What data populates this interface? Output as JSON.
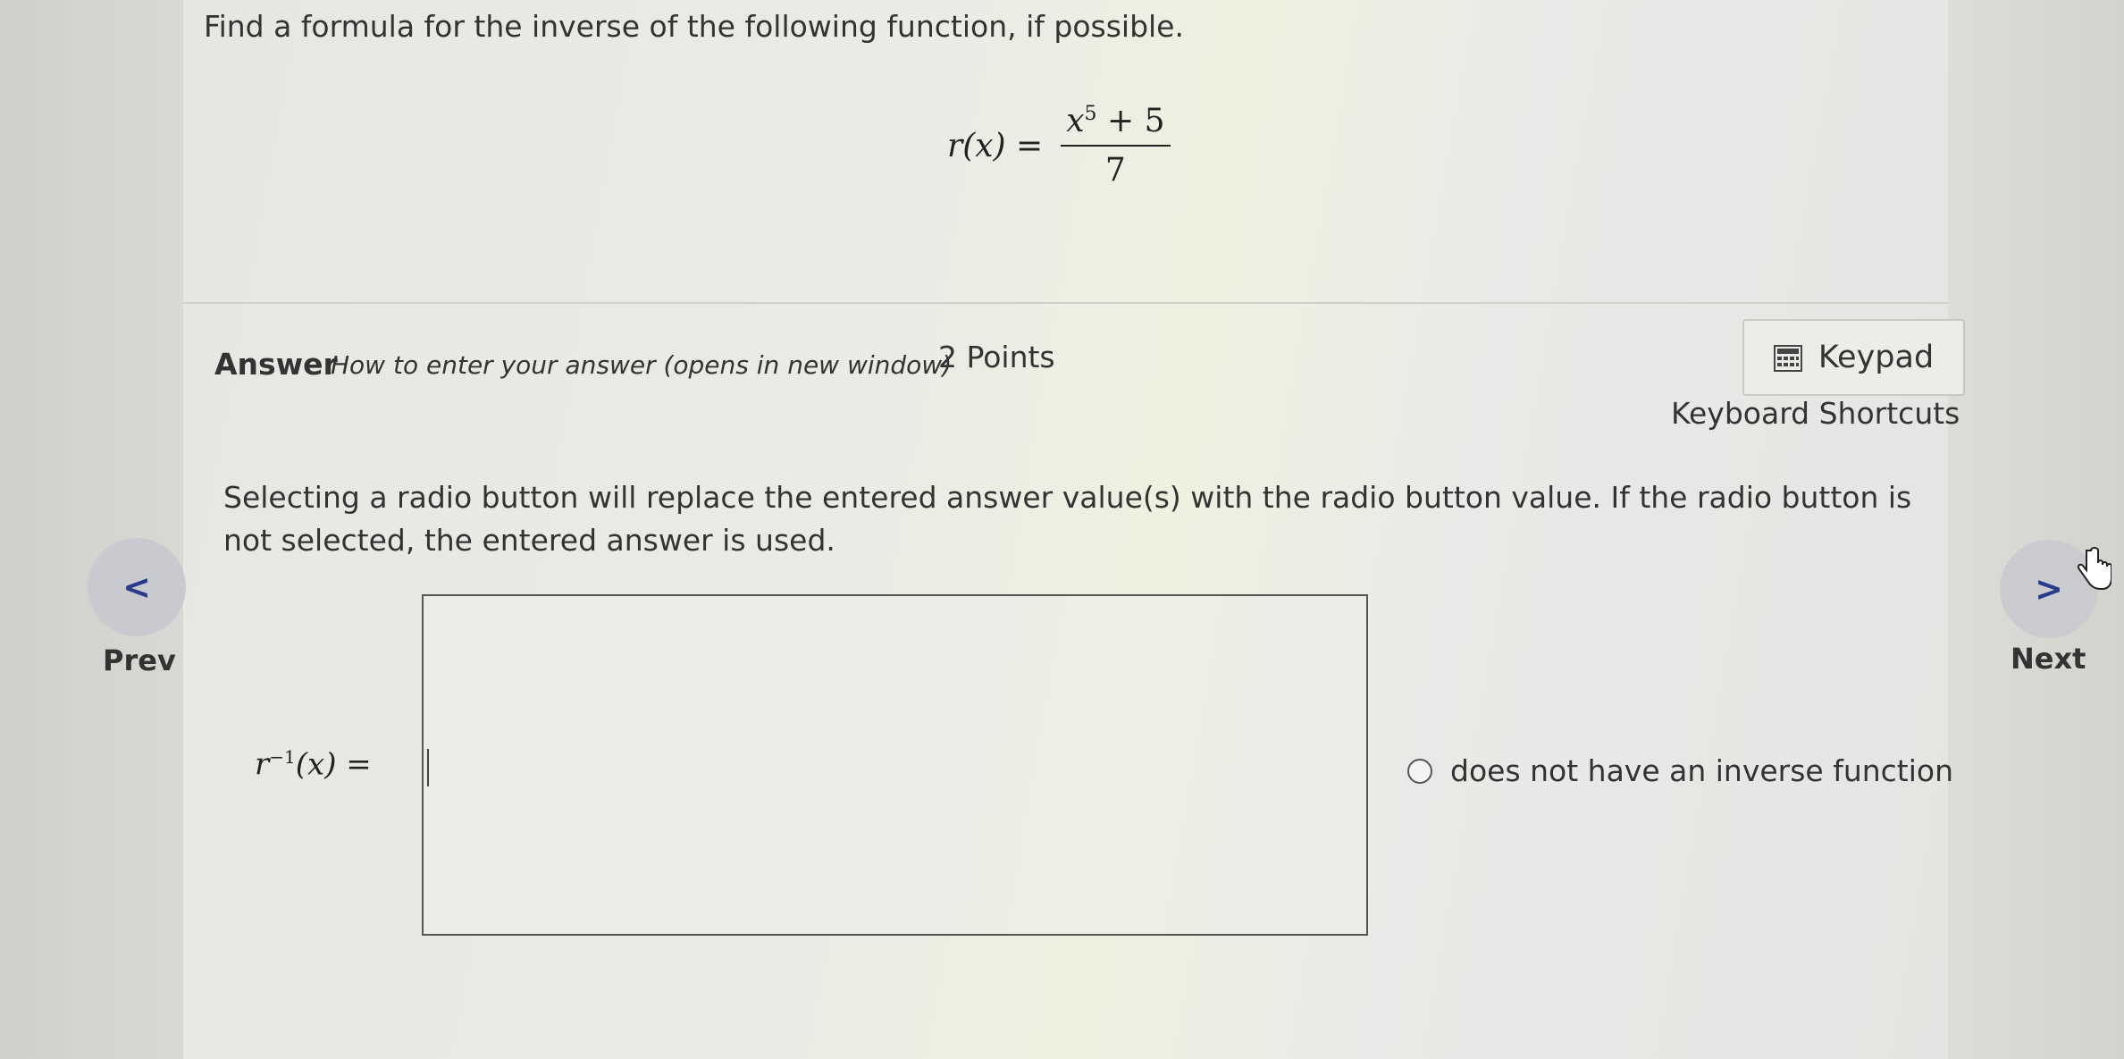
{
  "question": {
    "prompt": "Find a formula for the inverse of the following function, if possible.",
    "function_lhs": "r(x) =",
    "numerator_base": "x",
    "numerator_exponent": "5",
    "numerator_rest": " + 5",
    "denominator": "7"
  },
  "answer_header": {
    "label": "Answer",
    "howto_link": "How to enter your answer (opens in new window)",
    "points": "2 Points",
    "keypad_label": "Keypad",
    "shortcuts_link": "Keyboard Shortcuts"
  },
  "instructions": "Selecting a radio button will replace the entered answer value(s) with the radio button value. If the radio button is not selected, the entered answer is used.",
  "answer_input": {
    "label_base": "r",
    "label_sup": "−1",
    "label_rest": "(x) =",
    "value": ""
  },
  "radio_option": {
    "label": "does not have an inverse function",
    "selected": false
  },
  "navigation": {
    "prev_glyph": "<",
    "prev_label": "Prev",
    "next_glyph": ">",
    "next_label": "Next"
  }
}
